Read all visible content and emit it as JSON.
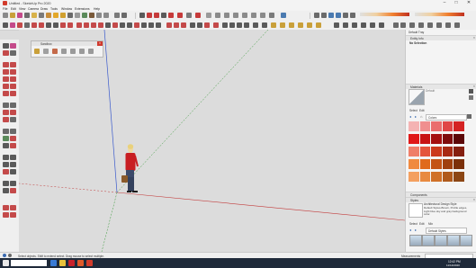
{
  "window": {
    "title": "Untitled - SketchUp Pro 2020",
    "minimize": "–",
    "maximize": "□",
    "close": "✕"
  },
  "menu": [
    "File",
    "Edit",
    "View",
    "Camera",
    "Draw",
    "Tools",
    "Window",
    "Extensions",
    "Help"
  ],
  "palette": {
    "title": "Sandbox",
    "close": "×"
  },
  "tray": {
    "title": "Default Tray",
    "entity_info": {
      "header": "Entity Info",
      "selection": "No Selection"
    },
    "materials": {
      "header": "Materials",
      "preview_label": "Default",
      "tabs": [
        "Select",
        "Edit"
      ],
      "dropdown": "Colors",
      "swatches": [
        [
          "#f4b3b3",
          "#f08f8f",
          "#ea6d6d",
          "#e04646",
          "#d42222"
        ],
        [
          "#e01818",
          "#c81414",
          "#a51010",
          "#7f0c0c",
          "#5c0808"
        ],
        [
          "#ef7e69",
          "#e4553c",
          "#cb3a1d",
          "#a82b14",
          "#852010"
        ],
        [
          "#f08a40",
          "#e06a1c",
          "#c45314",
          "#a0400e",
          "#7c300a"
        ],
        [
          "#f4a060",
          "#e88a40",
          "#d07028",
          "#b05a1c",
          "#8c4614"
        ]
      ]
    },
    "components": {
      "header": "Components"
    },
    "styles": {
      "header": "Styles",
      "style_name": "Architectural Design Style",
      "description": "Default Styles-Brown, Profile edges, Light blue sky and gray background color.",
      "tabs": [
        "Select",
        "Edit",
        "Mix"
      ],
      "dropdown": "Default Styles"
    }
  },
  "status": {
    "text": "Select objects. Shift to extend select. Drag mouse to select multiple.",
    "measurements_label": "Measurements"
  },
  "taskbar": {
    "time": "12:42 PM",
    "date": "11/12/2020"
  },
  "colors": {
    "red_axis": "#c23b3b",
    "green_axis": "#3a9a3a",
    "blue_axis": "#3a5acc"
  }
}
